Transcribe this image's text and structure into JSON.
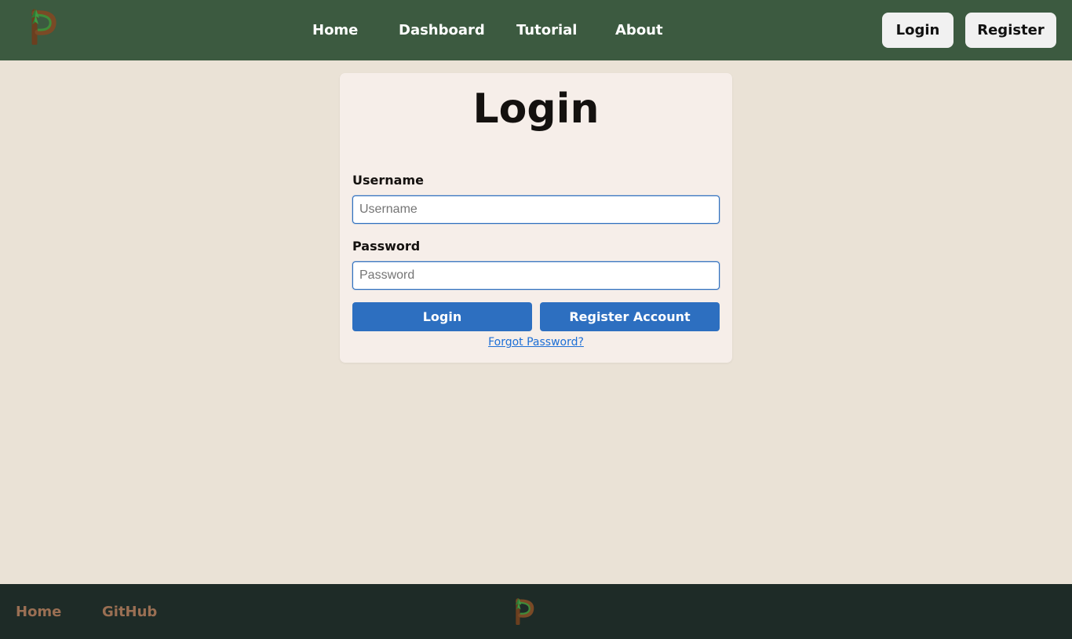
{
  "header": {
    "logo_icon": "p-tree-logo-icon",
    "nav": [
      {
        "label": "Home"
      },
      {
        "label": "Dashboard"
      },
      {
        "label": "Tutorial"
      },
      {
        "label": "About"
      }
    ],
    "login_button": "Login",
    "register_button": "Register",
    "colors": {
      "background": "#3c5a40",
      "button_bg": "#f1f1f1"
    }
  },
  "login_form": {
    "title": "Login",
    "username": {
      "label": "Username",
      "placeholder": "Username",
      "value": ""
    },
    "password": {
      "label": "Password",
      "placeholder": "Password",
      "value": ""
    },
    "submit_button": "Login",
    "register_button": "Register Account",
    "forgot_link": "Forgot Password?",
    "colors": {
      "card_bg": "#f6eee9",
      "accent": "#2d6fc0",
      "link": "#1d6fd6"
    }
  },
  "footer": {
    "links": [
      {
        "label": "Home"
      },
      {
        "label": "GitHub"
      }
    ],
    "logo_icon": "p-tree-logo-icon",
    "colors": {
      "background": "#1e2b27",
      "link": "#9a6f53"
    }
  },
  "page": {
    "background": "#eae2d6"
  }
}
